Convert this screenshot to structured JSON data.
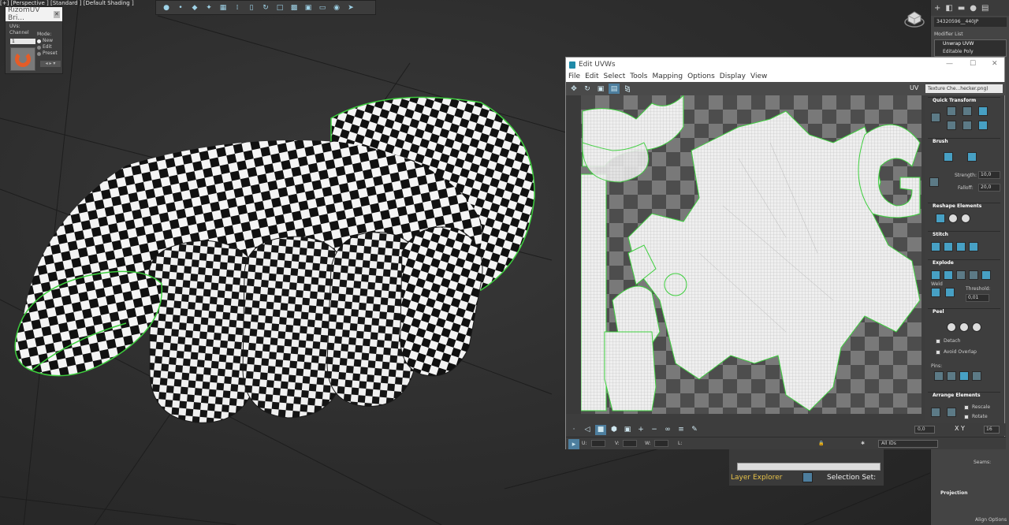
{
  "viewport": {
    "label": "[+] [Perspective ] [Standard ] [Default Shading ]"
  },
  "rizom": {
    "title": "RizomUV Bri...",
    "uvs_label": "UVs:",
    "channel_label": "Channel",
    "channel_value": "1",
    "mode_label": "Mode:",
    "modes": [
      "New",
      "Edit",
      "Preset"
    ],
    "selected_mode": "New"
  },
  "right_panel": {
    "object_name": "34320596__440JP",
    "modifier_list_label": "Modifier List",
    "modifiers": [
      "Unwrap UVW",
      "Editable Poly"
    ],
    "seams_label": "Seams:",
    "projection_label": "Projection",
    "align_options_label": "Align Options"
  },
  "uvw_window": {
    "title": "Edit UVWs",
    "menu": [
      "File",
      "Edit",
      "Select",
      "Tools",
      "Mapping",
      "Options",
      "Display",
      "View"
    ],
    "uv_label": "UV",
    "texture_select": "Texture Che...hecker.png)",
    "rollouts": {
      "quick_transform": "Quick Transform",
      "brush": "Brush",
      "strength_label": "Strength:",
      "strength_value": "10,0",
      "falloff_label": "Falloff:",
      "falloff_value": "20,0",
      "reshape": "Reshape Elements",
      "stitch": "Stitch",
      "explode": "Explode",
      "weld_label": "Weld",
      "threshold_label": "Threshold:",
      "threshold_value": "0,01",
      "peel": "Peel",
      "detach_label": "Detach",
      "avoid_overlap_label": "Avoid Overlap",
      "pins_label": "Pins:",
      "arrange": "Arrange Elements",
      "rescale_label": "Rescale",
      "rotate_label": "Rotate"
    },
    "bottom": {
      "u_label": "U:",
      "v_label": "V:",
      "w_label": "W:",
      "l_label": "L:",
      "all_ids": "All IDs",
      "zoom_value": "0,0",
      "xy_label": "X Y",
      "snap_value": "16"
    }
  },
  "layer_strip": {
    "layer_explorer_label": "Layer Explorer",
    "selection_set_label": "Selection Set:"
  },
  "colors": {
    "accent": "#1f8aa8",
    "seam_green": "#3ecf3e",
    "layer_label": "#e8c34a"
  }
}
